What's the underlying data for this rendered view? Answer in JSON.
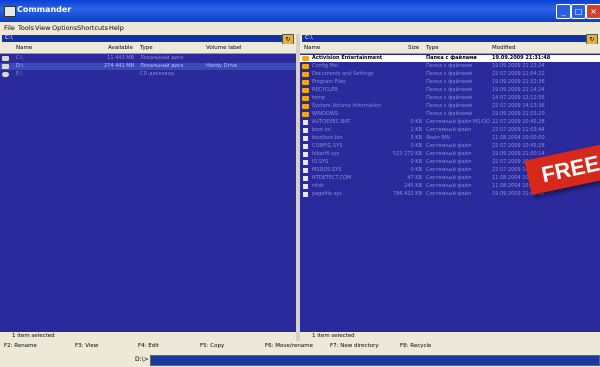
{
  "window": {
    "title": "Commander",
    "controls": [
      "_",
      "□",
      "×"
    ]
  },
  "menu": [
    "File",
    "Tools",
    "View",
    "Options",
    "Shortcuts",
    "Help"
  ],
  "left_panel": {
    "drive": "C:\\",
    "columns": [
      "Name",
      "Available",
      "Type",
      "Volume label"
    ],
    "rows": [
      {
        "name": "C:\\",
        "available": "11 443 MB",
        "type": "Локальный диск",
        "label": "",
        "selected": false
      },
      {
        "name": "D:\\",
        "available": "274 441 MB",
        "type": "Локальный диск",
        "label": "Handy Drive",
        "selected": true
      },
      {
        "name": "E:\\",
        "available": "",
        "type": "CD-дисковод",
        "label": "",
        "selected": false
      }
    ],
    "status": "1 item selected"
  },
  "right_panel": {
    "drive": "C:\\",
    "columns": [
      "Name",
      "Size",
      "Type",
      "Modified"
    ],
    "rows": [
      {
        "name": "Activision Entertainment",
        "size": "",
        "type": "Папка с файлами",
        "modified": "19.09.2009 21:31:48",
        "kind": "folder",
        "highlight": true
      },
      {
        "name": "Config.Msi",
        "size": "",
        "type": "Папка с файлами",
        "modified": "19.09.2009 21:23:24",
        "kind": "folder"
      },
      {
        "name": "Documents and Settings",
        "size": "",
        "type": "Папка с файлами",
        "modified": "22.07.2009 11:04:22",
        "kind": "folder"
      },
      {
        "name": "Program Files",
        "size": "",
        "type": "Папка с файлами",
        "modified": "19.09.2009 21:32:36",
        "kind": "folder"
      },
      {
        "name": "RECYCLER",
        "size": "",
        "type": "Папка с файлами",
        "modified": "19.09.2009 21:14:24",
        "kind": "folder"
      },
      {
        "name": "temp",
        "size": "",
        "type": "Папка с файлами",
        "modified": "14.07.2009 12:12:56",
        "kind": "folder"
      },
      {
        "name": "System Volume Information",
        "size": "",
        "type": "Папка с файлами",
        "modified": "22.07.2009 14:13:36",
        "kind": "folder"
      },
      {
        "name": "WINDOWS",
        "size": "",
        "type": "Папка с файлами",
        "modified": "19.09.2009 21:03:20",
        "kind": "folder"
      },
      {
        "name": "AUTOEXEC.BAT",
        "size": "0 KB",
        "type": "Системный файл MS-DOS",
        "modified": "22.07.2009 10:45:28",
        "kind": "file"
      },
      {
        "name": "boot.ini",
        "size": "1 KB",
        "type": "Системный файл",
        "modified": "22.07.2009 11:03:44",
        "kind": "file"
      },
      {
        "name": "bootfont.bin",
        "size": "5 KB",
        "type": "Файл BIN",
        "modified": "11.08.2004 10:00:00",
        "kind": "file"
      },
      {
        "name": "CONFIG.SYS",
        "size": "0 KB",
        "type": "Системный файл",
        "modified": "22.07.2009 10:45:28",
        "kind": "file"
      },
      {
        "name": "hiberfil.sys",
        "size": "523 272 KB",
        "type": "Системный файл",
        "modified": "19.09.2009 21:00:14",
        "kind": "file"
      },
      {
        "name": "IO.SYS",
        "size": "0 KB",
        "type": "Системный файл",
        "modified": "22.07.2009 10:45:28",
        "kind": "file"
      },
      {
        "name": "MSDOS.SYS",
        "size": "0 KB",
        "type": "Системный файл",
        "modified": "22.07.2009 10:45:28",
        "kind": "file"
      },
      {
        "name": "NTDETECT.COM",
        "size": "47 KB",
        "type": "Системный файл",
        "modified": "11.08.2004 10:00:00",
        "kind": "file"
      },
      {
        "name": "ntldr",
        "size": "245 KB",
        "type": "Системный файл",
        "modified": "11.08.2004 10:00:00",
        "kind": "file"
      },
      {
        "name": "pagefile.sys",
        "size": "786 432 KB",
        "type": "Системный файл",
        "modified": "19.09.2009 21:00:12",
        "kind": "file"
      }
    ],
    "status": "1 item selected"
  },
  "fkeys": [
    "F2: Rename",
    "F3: View",
    "F4: Edit",
    "F5: Copy",
    "F6: Move/rename",
    "F7: New directory",
    "F8: Recycle"
  ],
  "cmdline": {
    "prompt": "D:\\>",
    "value": ""
  },
  "banner": {
    "text": "FREE"
  }
}
